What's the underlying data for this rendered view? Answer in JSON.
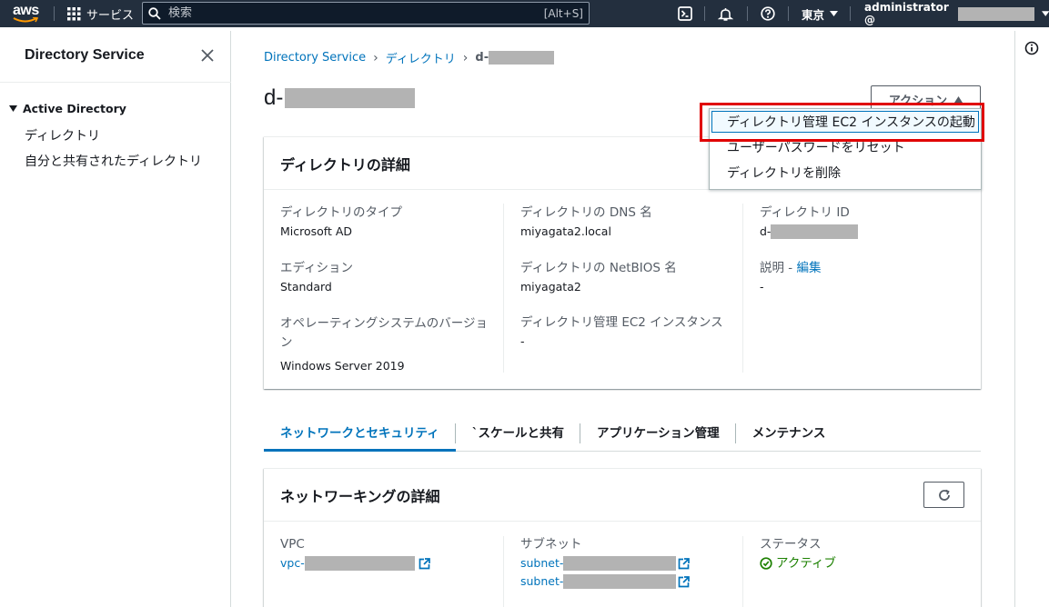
{
  "topbar": {
    "logo": "aws",
    "services": "サービス",
    "search_placeholder": "検索",
    "search_shortcut": "[Alt+S]",
    "region": "東京",
    "account": "administrator @"
  },
  "sidebar": {
    "title": "Directory Service",
    "section": "Active Directory",
    "items": [
      {
        "label": "ディレクトリ"
      },
      {
        "label": "自分と共有されたディレクトリ"
      }
    ]
  },
  "breadcrumb": {
    "items": [
      "Directory Service",
      "ディレクトリ"
    ],
    "current_prefix": "d-"
  },
  "page": {
    "title_prefix": "d-",
    "actions_label": "アクション"
  },
  "actions_menu": {
    "items": [
      {
        "label": "ディレクトリ管理 EC2 インスタンスの起動"
      },
      {
        "label": "ユーザーパスワードをリセット"
      },
      {
        "label": "ディレクトリを削除"
      }
    ]
  },
  "details": {
    "title": "ディレクトリの詳細",
    "type_label": "ディレクトリのタイプ",
    "type_value": "Microsoft AD",
    "edition_label": "エディション",
    "edition_value": "Standard",
    "os_label": "オペレーティングシステムのバージョン",
    "os_value": "Windows Server 2019",
    "dns_label": "ディレクトリの DNS 名",
    "dns_value": "miyagata2.local",
    "netbios_label": "ディレクトリの NetBIOS 名",
    "netbios_value": "miyagata2",
    "ec2_label": "ディレクトリ管理 EC2 インスタンス",
    "ec2_value": "-",
    "id_label": "ディレクトリ ID",
    "id_prefix": "d-",
    "desc_label": "説明 - ",
    "desc_edit": "編集",
    "desc_value": "-"
  },
  "tabs": [
    {
      "label": "ネットワークとセキュリティ"
    },
    {
      "label": "`スケールと共有"
    },
    {
      "label": "アプリケーション管理"
    },
    {
      "label": "メンテナンス"
    }
  ],
  "networking": {
    "title": "ネットワーキングの詳細",
    "vpc_label": "VPC",
    "vpc_prefix": "vpc-",
    "subnet_label": "サブネット",
    "subnet_prefix_1": "subnet-",
    "subnet_prefix_2": "subnet-",
    "status_label": "ステータス",
    "status_value": "アクティブ"
  },
  "colors": {
    "topbar": "#232f3e",
    "link": "#0073bb",
    "success": "#1d8102",
    "highlight_box": "#e00000"
  }
}
